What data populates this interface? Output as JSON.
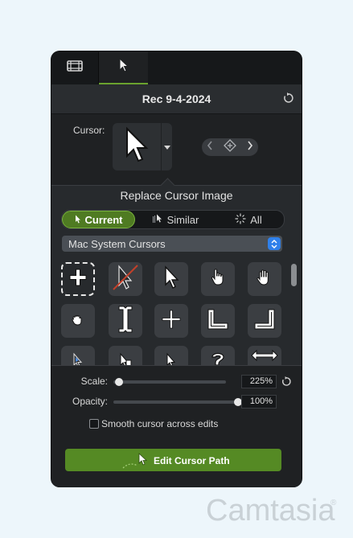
{
  "tabs": [
    {
      "name": "media-tab",
      "icon": "film-strip-icon"
    },
    {
      "name": "cursor-tab",
      "icon": "cursor-icon",
      "active": true
    }
  ],
  "header": {
    "title": "Rec 9-4-2024",
    "reset_icon": "reset-icon"
  },
  "cursor": {
    "label": "Cursor:"
  },
  "replace": {
    "title": "Replace Cursor Image",
    "segments": [
      {
        "label": "Current",
        "icon": "cursor-icon",
        "active": true
      },
      {
        "label": "Similar",
        "icon": "similar-cursor-icon"
      },
      {
        "label": "All",
        "icon": "sparkle-icon"
      }
    ],
    "set_select": "Mac System Cursors"
  },
  "cursor_set": [
    "crosshair-cursor",
    "no-cursor",
    "arrow-cursor",
    "hand-pointer-cursor",
    "open-hand-cursor",
    "grab-cursor",
    "ibeam-cursor",
    "move-cursor",
    "resize-corner-cursor",
    "resize-corner-cursor-alt",
    "arrow-small-cursor",
    "arrow-copy-cursor",
    "arrow-small-cursor-2",
    "help-cursor",
    "resize-cursor"
  ],
  "scale": {
    "label": "Scale:",
    "value": "225%",
    "level": 0.05
  },
  "opacity": {
    "label": "Opacity:",
    "value": "100%",
    "level": 1.0
  },
  "smooth": {
    "label": "Smooth cursor across edits",
    "checked": false
  },
  "edit_button": {
    "label": "Edit Cursor Path"
  },
  "brand": {
    "name": "Camtasia",
    "reg": "®"
  },
  "colors": {
    "accent": "#558a24",
    "panel": "#1f2123",
    "background": "#edf6fb"
  }
}
